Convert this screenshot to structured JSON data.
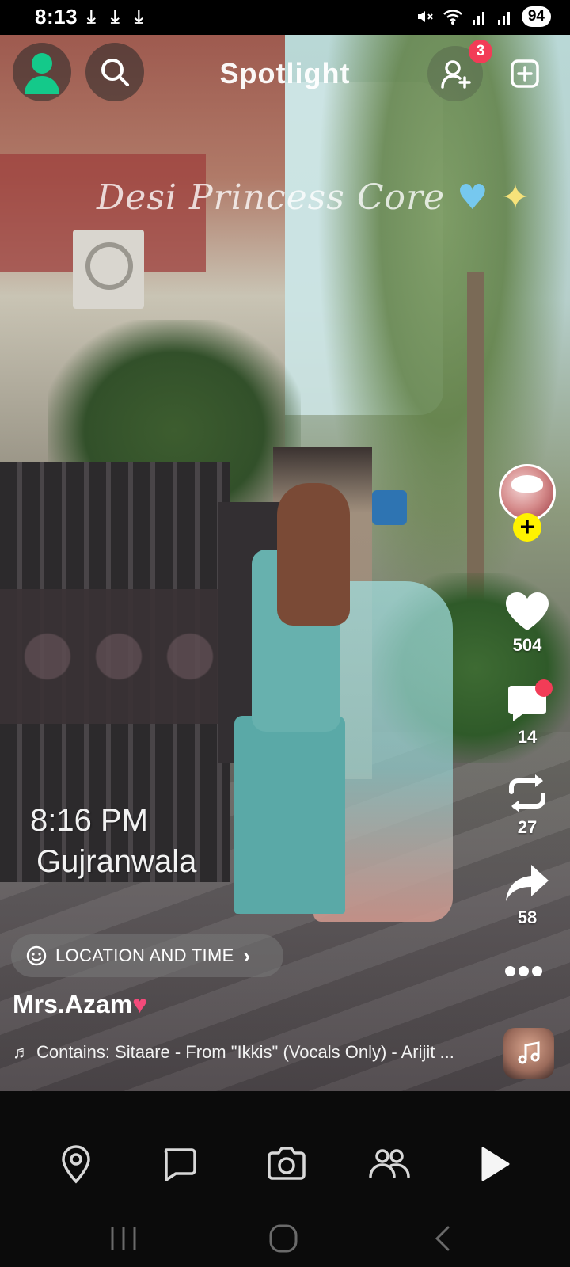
{
  "status_bar": {
    "time": "8:13",
    "download_icons": [
      "download-icon",
      "download-icon",
      "download-icon"
    ],
    "battery": "94",
    "icons": [
      "mute-icon",
      "wifi-icon",
      "signal-icon",
      "signal-icon"
    ]
  },
  "top_bar": {
    "title": "Spotlight",
    "add_friend_badge": "3"
  },
  "video": {
    "overlay_text": "Desi Princess Core",
    "stamp_time": "8:16 PM",
    "stamp_city": "Gujranwala"
  },
  "actions": {
    "likes": "504",
    "comments": "14",
    "remixes": "27",
    "shares": "58"
  },
  "location_chip": {
    "label": "LOCATION AND TIME"
  },
  "post": {
    "username": "Mrs.Azam",
    "music": "Contains: Sitaare - From \"Ikkis\" (Vocals Only) - Arijit ..."
  },
  "bottom_nav": [
    "map-pin-icon",
    "chat-icon",
    "camera-icon",
    "stories-icon",
    "spotlight-play-icon"
  ],
  "colors": {
    "accent_green": "#14c98a",
    "badge_red": "#f23c57",
    "follow_yellow": "#fff200"
  }
}
